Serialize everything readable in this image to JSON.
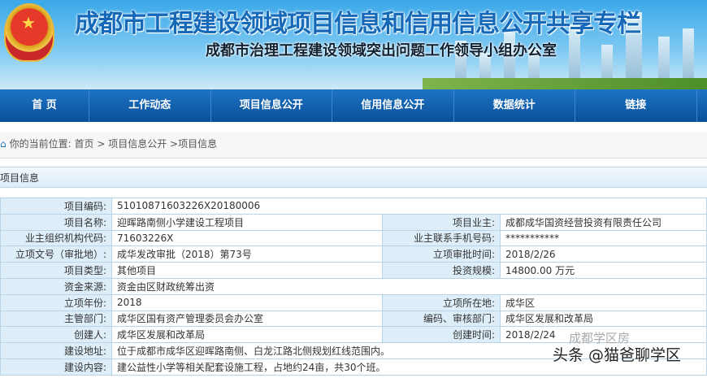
{
  "header": {
    "title": "成都市工程建设领域项目信息和信用信息公开共享专栏",
    "subtitle": "成都市治理工程建设领域突出问题工作领导小组办公室"
  },
  "nav": [
    "首 页",
    "工作动态",
    "项目信息公开",
    "信用信息公开",
    "数据统计",
    "链接"
  ],
  "breadcrumb": {
    "prefix": "你的当前位置:",
    "items": [
      "首页",
      " > 项目信息公开",
      " >项目信息"
    ]
  },
  "section_title": "项目信息",
  "rows": [
    {
      "label": "项目编码:",
      "value": "51010871603226X20180006"
    },
    {
      "label": "项目名称:",
      "value": "迎晖路南侧小学建设工程项目",
      "label2": "项目业主:",
      "value2": "成都成华国资经营投资有限责任公司"
    },
    {
      "label": "业主组织机构代码:",
      "value": "71603226X",
      "label2": "业主联系手机号码:",
      "value2": "***********"
    },
    {
      "label": "立项文号（审批地）:",
      "value": "成华发改审批（2018）第73号",
      "label2": "立项审批时间:",
      "value2": "2018/2/26"
    },
    {
      "label": "项目类型:",
      "value": "其他项目",
      "label2": "投资规模:",
      "value2": "14800.00 万元"
    },
    {
      "label": "资金来源:",
      "value": "资金由区财政统筹出资"
    },
    {
      "label": "立项年份:",
      "value": "2018",
      "label2": "立项所在地:",
      "value2": "成华区"
    },
    {
      "label": "主管部门:",
      "value": "成华区国有资产管理委员会办公室",
      "label2": "编码、审核部门:",
      "value2": "成华区发展和改革局"
    },
    {
      "label": "创建人:",
      "value": "成华区发展和改革局",
      "label2": "创建时间:",
      "value2": "2018/2/24"
    },
    {
      "label": "建设地址:",
      "value": "位于成都市成华区迎晖路南侧、白龙江路北侧规划红线范围内。"
    },
    {
      "label": "建设内容:",
      "value": "建公益性小学等相关配套设施工程，占地约24亩，共30个班。"
    }
  ],
  "watermark": {
    "line1": "成都学区房",
    "line2": "头条 @猫爸聊学区"
  }
}
